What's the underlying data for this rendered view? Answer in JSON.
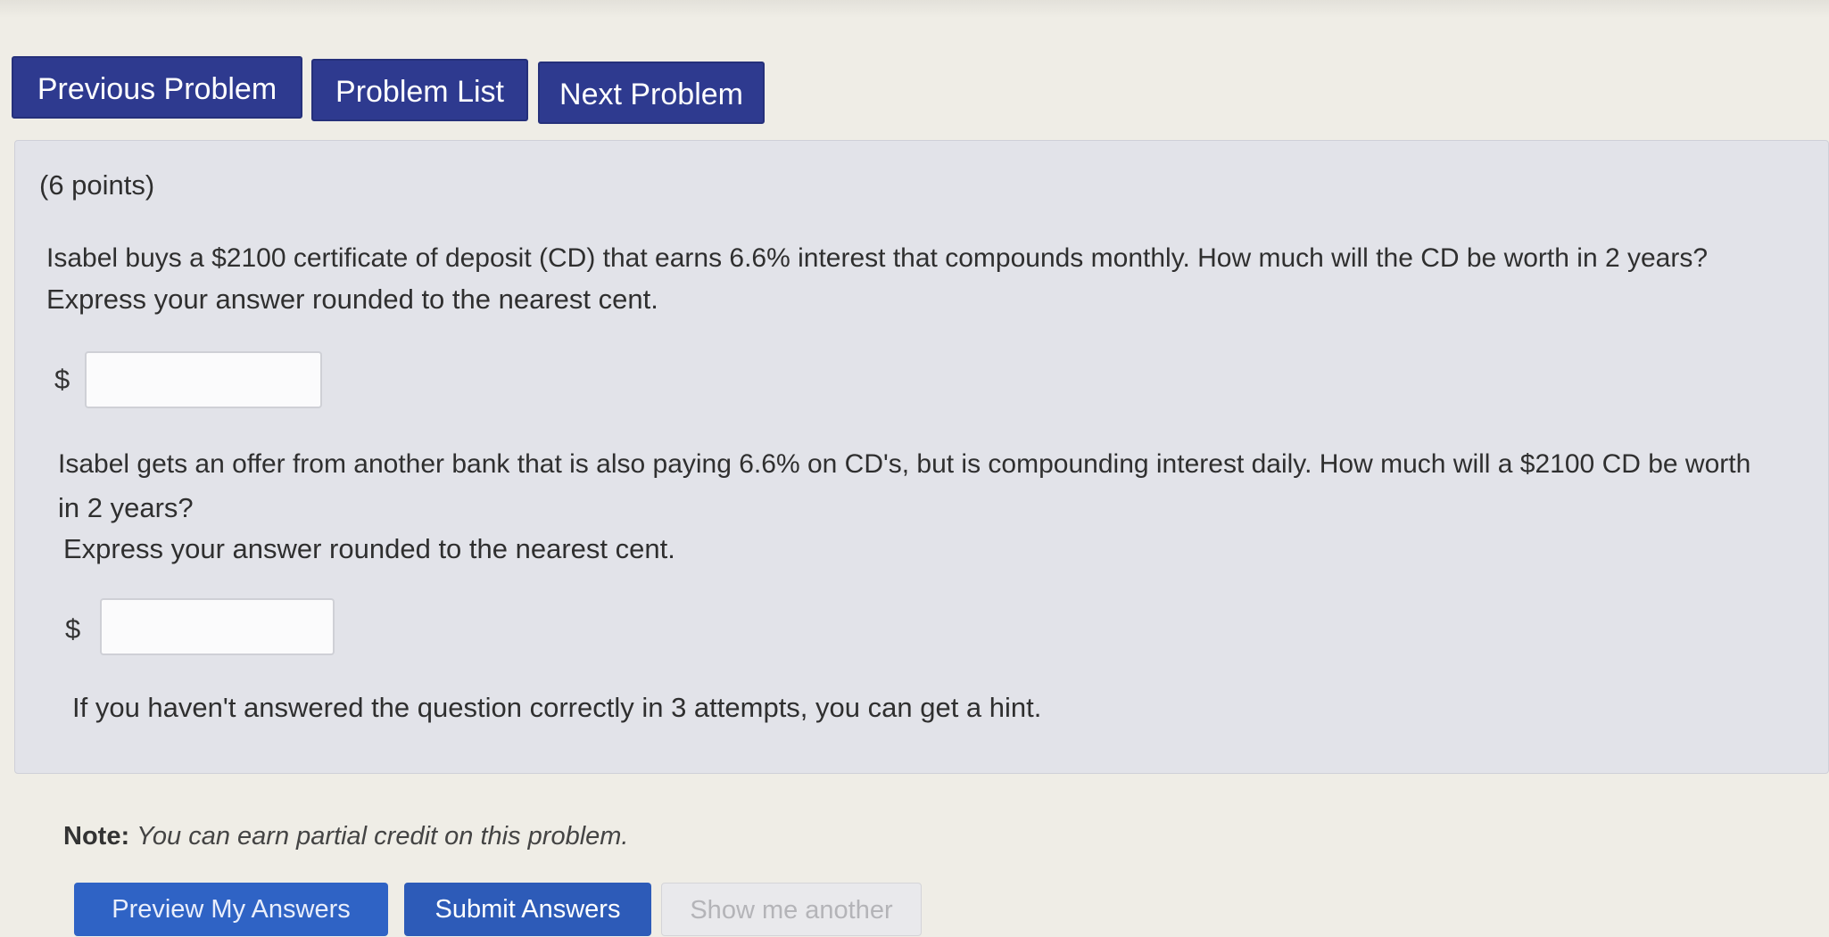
{
  "nav": {
    "previous": "Previous Problem",
    "list": "Problem List",
    "next": "Next Problem"
  },
  "problem": {
    "points": "(6 points)",
    "part1": {
      "question_line1": "Isabel buys a $2100 certificate of deposit (CD) that earns 6.6% interest that compounds monthly. How much will the CD be worth in 2 years?",
      "question_line2": "Express your answer rounded to the nearest cent.",
      "currency": "$",
      "answer": ""
    },
    "part2": {
      "question_line1": "Isabel gets an offer from another bank that is also paying 6.6% on CD's, but is compounding interest daily. How much will a $2100 CD be worth",
      "question_line2": "in 2 years?",
      "question_line3": "Express your answer rounded to the nearest cent.",
      "currency": "$",
      "answer": ""
    },
    "hint_text": "If you haven't answered the question correctly in 3 attempts, you can get a hint."
  },
  "note": {
    "label": "Note:",
    "text": "You can earn partial credit on this problem."
  },
  "actions": {
    "preview": "Preview My Answers",
    "submit": "Submit Answers",
    "another": "Show me another"
  }
}
